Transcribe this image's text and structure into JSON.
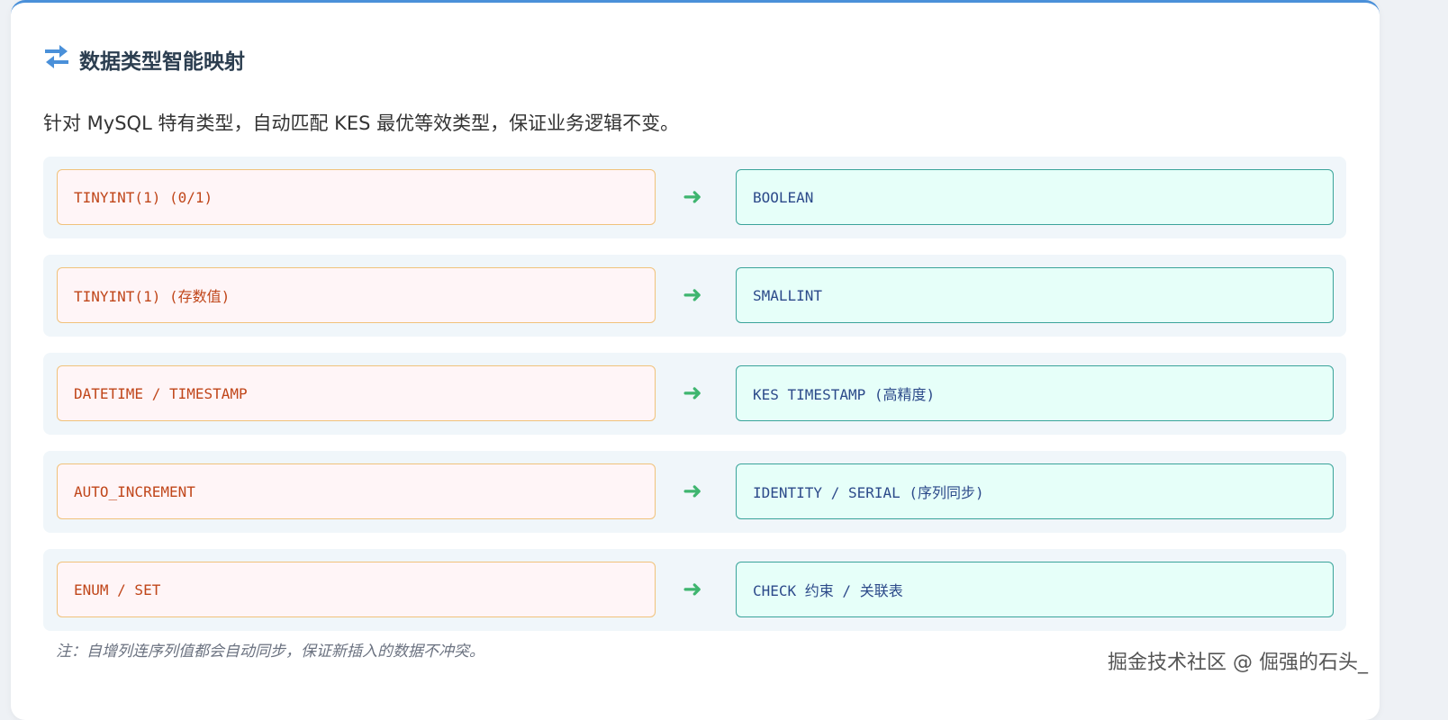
{
  "header": {
    "title": "数据类型智能映射",
    "icon": "swap-arrows-icon"
  },
  "description": "针对 MySQL 特有类型，自动匹配 KES 最优等效类型，保证业务逻辑不变。",
  "mappings": [
    {
      "from": "TINYINT(1) (0/1)",
      "to": "BOOLEAN"
    },
    {
      "from": "TINYINT(1) (存数值)",
      "to": "SMALLINT"
    },
    {
      "from": "DATETIME / TIMESTAMP",
      "to": "KES TIMESTAMP (高精度)"
    },
    {
      "from": "AUTO_INCREMENT",
      "to": "IDENTITY / SERIAL (序列同步)"
    },
    {
      "from": "ENUM / SET",
      "to": "CHECK 约束 / 关联表"
    }
  ],
  "arrow": "➜",
  "note": "注：自增列连序列值都会自动同步，保证新插入的数据不冲突。",
  "watermark": "掘金技术社区 @ 倔强的石头_",
  "colors": {
    "accent": "#4a90d9",
    "arrow": "#3fb56f",
    "source_text": "#c0461a",
    "target_text": "#2c4a8a"
  }
}
